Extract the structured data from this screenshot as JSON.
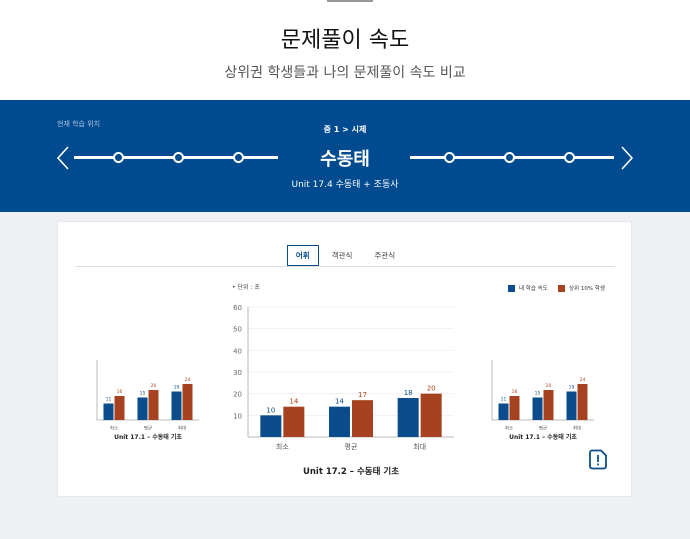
{
  "header": {
    "title": "문제풀이 속도",
    "subtitle": "상위권 학생들과 나의 문제풀이 속도 비교"
  },
  "banner": {
    "location_label": "현재 학습 위치",
    "breadcrumb": "중 1 > 시제",
    "unit_title": "수동태",
    "unit_subtitle": "Unit 17.4 수동태 + 조동사"
  },
  "tabs": [
    {
      "label": "어휘",
      "active": true
    },
    {
      "label": "객관식",
      "active": false
    },
    {
      "label": "주관식",
      "active": false
    }
  ],
  "colors": {
    "mine": "#0a4c8c",
    "top": "#a64220",
    "banner": "#004a8f"
  },
  "legend": {
    "mine": "내 학습 속도",
    "top": "상위 10% 학생"
  },
  "unit_note": "• 단위 : 초",
  "icons": [
    "chevron-left-icon",
    "chevron-right-icon",
    "alert-info-icon"
  ],
  "chart_data": [
    {
      "type": "bar",
      "title": "Unit 17.1 – 수동태 기초",
      "categories": [
        "최소",
        "평균",
        "최대"
      ],
      "series": [
        {
          "name": "내 학습 속도",
          "values": [
            11,
            15,
            19
          ]
        },
        {
          "name": "상위 10% 학생",
          "values": [
            16,
            20,
            24
          ]
        }
      ]
    },
    {
      "type": "bar",
      "title": "Unit 17.2 – 수동태 기초",
      "categories": [
        "최소",
        "평균",
        "최대"
      ],
      "ylim": [
        0,
        60
      ],
      "yticks": [
        10,
        20,
        30,
        40,
        50,
        60
      ],
      "series": [
        {
          "name": "내 학습 속도",
          "values": [
            10,
            14,
            18
          ]
        },
        {
          "name": "상위 10% 학생",
          "values": [
            14,
            17,
            20
          ]
        }
      ]
    },
    {
      "type": "bar",
      "title": "Unit 17.1 – 수동태 기초",
      "categories": [
        "최소",
        "평균",
        "최대"
      ],
      "series": [
        {
          "name": "내 학습 속도",
          "values": [
            11,
            15,
            19
          ]
        },
        {
          "name": "상위 10% 학생",
          "values": [
            16,
            20,
            24
          ]
        }
      ]
    }
  ]
}
